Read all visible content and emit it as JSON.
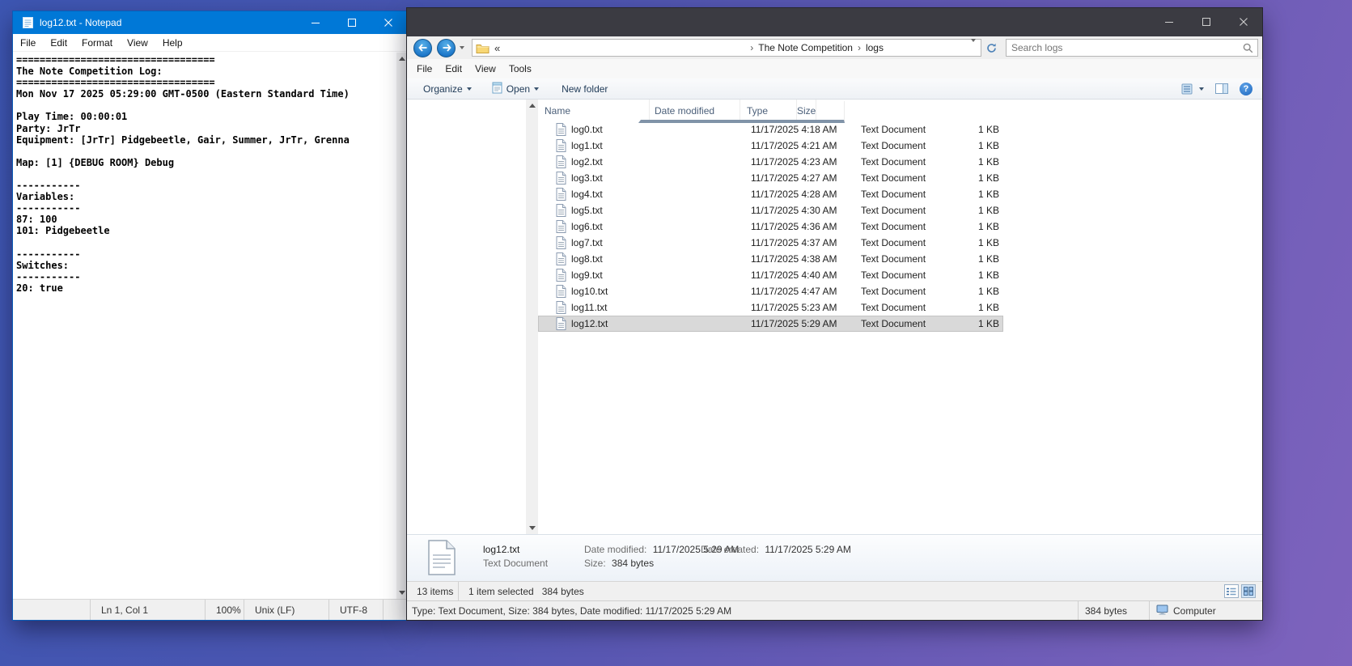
{
  "notepad": {
    "title": "log12.txt - Notepad",
    "menu": [
      "File",
      "Edit",
      "Format",
      "View",
      "Help"
    ],
    "content": "==================================\nThe Note Competition Log:\n==================================\nMon Nov 17 2025 05:29:00 GMT-0500 (Eastern Standard Time)\n\nPlay Time: 00:00:01\nParty: JrTr\nEquipment: [JrTr] Pidgebeetle, Gair, Summer, JrTr, Grenna\n\nMap: [1] {DEBUG ROOM} Debug\n\n-----------\nVariables:\n-----------\n87: 100\n101: Pidgebeetle\n\n-----------\nSwitches:\n-----------\n20: true",
    "status": {
      "cursor": "Ln 1, Col 1",
      "zoom": "100%",
      "eol": "Unix (LF)",
      "encoding": "UTF-8"
    }
  },
  "explorer": {
    "menu": [
      "File",
      "Edit",
      "View",
      "Tools"
    ],
    "address": {
      "overflow": "«",
      "breadcrumbs": [
        "The Note Competition",
        "logs"
      ]
    },
    "search": {
      "placeholder": "Search logs"
    },
    "toolbar": {
      "organize": "Organize",
      "open": "Open",
      "new_folder": "New folder"
    },
    "columns": [
      "Name",
      "Date modified",
      "Type",
      "Size"
    ],
    "files": [
      {
        "name": "log0.txt",
        "modified": "11/17/2025 4:18 AM",
        "type": "Text Document",
        "size": "1 KB",
        "selected": false
      },
      {
        "name": "log1.txt",
        "modified": "11/17/2025 4:21 AM",
        "type": "Text Document",
        "size": "1 KB",
        "selected": false
      },
      {
        "name": "log2.txt",
        "modified": "11/17/2025 4:23 AM",
        "type": "Text Document",
        "size": "1 KB",
        "selected": false
      },
      {
        "name": "log3.txt",
        "modified": "11/17/2025 4:27 AM",
        "type": "Text Document",
        "size": "1 KB",
        "selected": false
      },
      {
        "name": "log4.txt",
        "modified": "11/17/2025 4:28 AM",
        "type": "Text Document",
        "size": "1 KB",
        "selected": false
      },
      {
        "name": "log5.txt",
        "modified": "11/17/2025 4:30 AM",
        "type": "Text Document",
        "size": "1 KB",
        "selected": false
      },
      {
        "name": "log6.txt",
        "modified": "11/17/2025 4:36 AM",
        "type": "Text Document",
        "size": "1 KB",
        "selected": false
      },
      {
        "name": "log7.txt",
        "modified": "11/17/2025 4:37 AM",
        "type": "Text Document",
        "size": "1 KB",
        "selected": false
      },
      {
        "name": "log8.txt",
        "modified": "11/17/2025 4:38 AM",
        "type": "Text Document",
        "size": "1 KB",
        "selected": false
      },
      {
        "name": "log9.txt",
        "modified": "11/17/2025 4:40 AM",
        "type": "Text Document",
        "size": "1 KB",
        "selected": false
      },
      {
        "name": "log10.txt",
        "modified": "11/17/2025 4:47 AM",
        "type": "Text Document",
        "size": "1 KB",
        "selected": false
      },
      {
        "name": "log11.txt",
        "modified": "11/17/2025 5:23 AM",
        "type": "Text Document",
        "size": "1 KB",
        "selected": false
      },
      {
        "name": "log12.txt",
        "modified": "11/17/2025 5:29 AM",
        "type": "Text Document",
        "size": "1 KB",
        "selected": true
      }
    ],
    "details": {
      "name": "log12.txt",
      "type": "Text Document",
      "modified_label": "Date modified:",
      "modified": "11/17/2025 5:29 AM",
      "created_label": "Date created:",
      "created": "11/17/2025 5:29 AM",
      "size_label": "Size:",
      "size": "384 bytes"
    },
    "items_bar": {
      "count": "13 items",
      "selected": "1 item selected",
      "selected_size": "384 bytes"
    },
    "status_bar": {
      "info": "Type: Text Document, Size: 384 bytes, Date modified: 11/17/2025 5:29 AM",
      "size": "384 bytes",
      "location": "Computer"
    }
  },
  "colors": {
    "notepad_titlebar": "#0078d7",
    "explorer_titlebar": "#3b3b42",
    "selection_gray": "#d9d9d9"
  }
}
